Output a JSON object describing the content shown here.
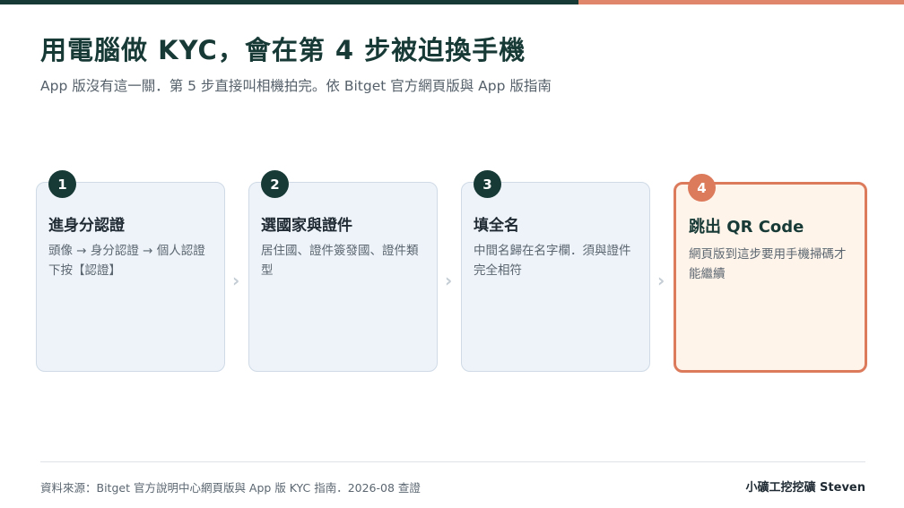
{
  "header": {
    "title": "用電腦做 KYC，會在第 4 步被迫換手機",
    "subtitle": "App 版沒有這一關．第 5 步直接叫相機拍完。依 Bitget 官方網頁版與 App 版指南"
  },
  "steps": [
    {
      "number": "1",
      "title": "進身分認證",
      "desc": "頭像 → 身分認證 → 個人認證下按【認證】"
    },
    {
      "number": "2",
      "title": "選國家與證件",
      "desc": "居住國、證件簽發國、證件類型"
    },
    {
      "number": "3",
      "title": "填全名",
      "desc": "中間名歸在名字欄．須與證件完全相符"
    },
    {
      "number": "4",
      "title": "跳出 QR Code",
      "desc": "網頁版到這步要用手機掃碼才能繼續"
    }
  ],
  "chevron_glyph": "›",
  "footer": {
    "source": "資料來源：Bitget 官方說明中心網頁版與 App 版 KYC 指南．2026-08 查證",
    "author": "小礦工挖挖礦 Steven"
  },
  "colors": {
    "primary": "#173a36",
    "accent": "#dc7a5c",
    "card_bg": "#eef3f9",
    "highlight_bg": "#fff4ea"
  }
}
